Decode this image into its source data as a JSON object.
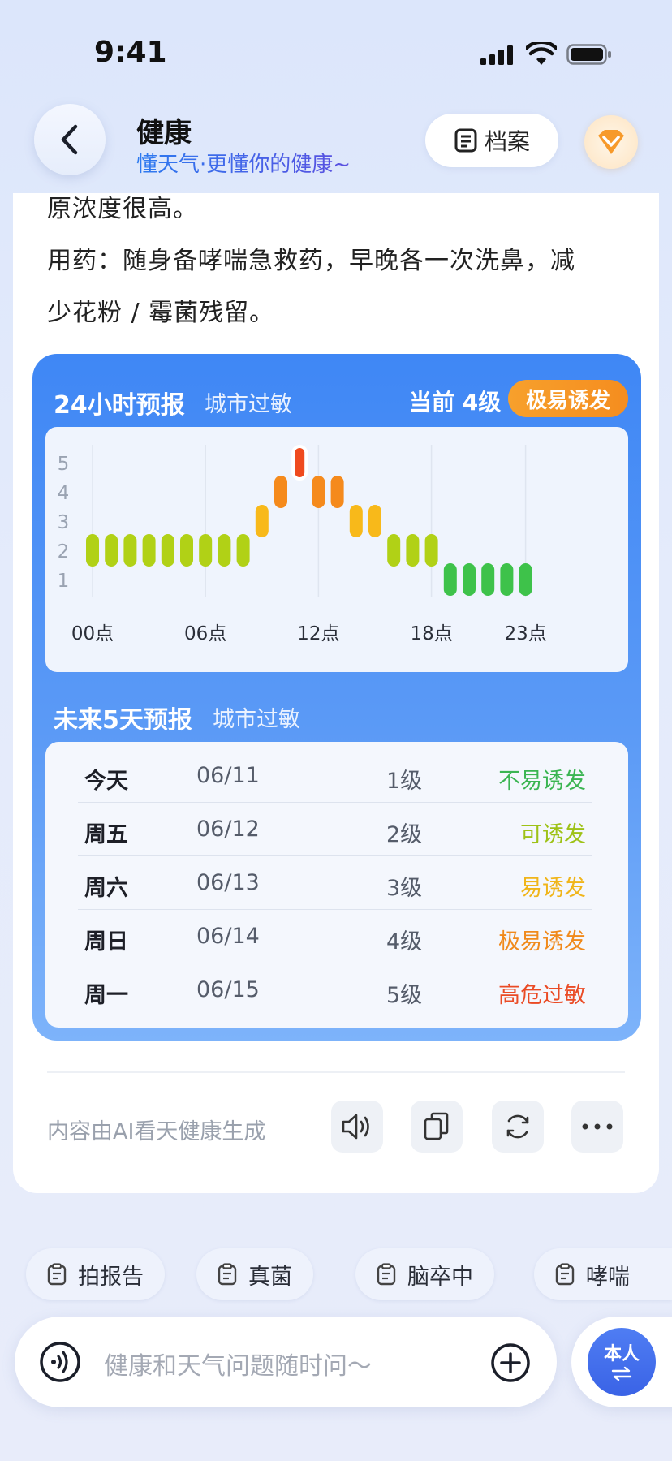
{
  "status_bar": {
    "time": "9:41"
  },
  "header": {
    "title": "健康",
    "subtitle": "懂天气·更懂你的健康~",
    "archive_label": "档案"
  },
  "message": {
    "lines": [
      "原浓度很高。",
      "用药：随身备哮喘急救药，早晚各一次洗鼻，减",
      "少花粉 / 霉菌残留。"
    ]
  },
  "hourly": {
    "title": "24小时预报",
    "subtitle": "城市过敏",
    "current": "当前 4级",
    "badge": "极易诱发"
  },
  "chart_data": {
    "type": "bar",
    "title": "24小时预报",
    "x_tick_labels": [
      "00点",
      "06点",
      "12点",
      "18点",
      "23点"
    ],
    "y_ticks": [
      "1",
      "2",
      "3",
      "4",
      "5"
    ],
    "ylim": [
      1,
      5
    ],
    "hours": [
      0,
      1,
      2,
      3,
      4,
      5,
      6,
      7,
      8,
      9,
      10,
      11,
      12,
      13,
      14,
      15,
      16,
      17,
      18,
      19,
      20,
      21,
      22,
      23
    ],
    "values": [
      2,
      2,
      2,
      2,
      2,
      2,
      2,
      2,
      2,
      3,
      4,
      5,
      4,
      4,
      3,
      3,
      2,
      2,
      2,
      1,
      1,
      1,
      1,
      1
    ],
    "current_hour": 11,
    "level_colors": {
      "1": "#3ec24a",
      "2": "#b1d116",
      "3": "#f8b91a",
      "4": "#f58a1c",
      "5": "#ef4a1e"
    },
    "grid": true
  },
  "daily": {
    "title": "未来5天预报",
    "subtitle": "城市过敏",
    "rows": [
      {
        "day": "今天",
        "date": "06/11",
        "level": "1级",
        "desc": "不易诱发",
        "color": "#3bb552"
      },
      {
        "day": "周五",
        "date": "06/12",
        "level": "2级",
        "desc": "可诱发",
        "color": "#9ec217"
      },
      {
        "day": "周六",
        "date": "06/13",
        "level": "3级",
        "desc": "易诱发",
        "color": "#f0b51a"
      },
      {
        "day": "周日",
        "date": "06/14",
        "level": "4级",
        "desc": "极易诱发",
        "color": "#f08a1c"
      },
      {
        "day": "周一",
        "date": "06/15",
        "level": "5级",
        "desc": "高危过敏",
        "color": "#ea4b25"
      }
    ]
  },
  "footer": {
    "ai_note": "内容由AI看天健康生成"
  },
  "chips": [
    "拍报告",
    "真菌",
    "脑卒中",
    "哮喘"
  ],
  "input": {
    "placeholder": "健康和天气问题随时问～"
  },
  "profile_switch": {
    "label": "本人"
  }
}
